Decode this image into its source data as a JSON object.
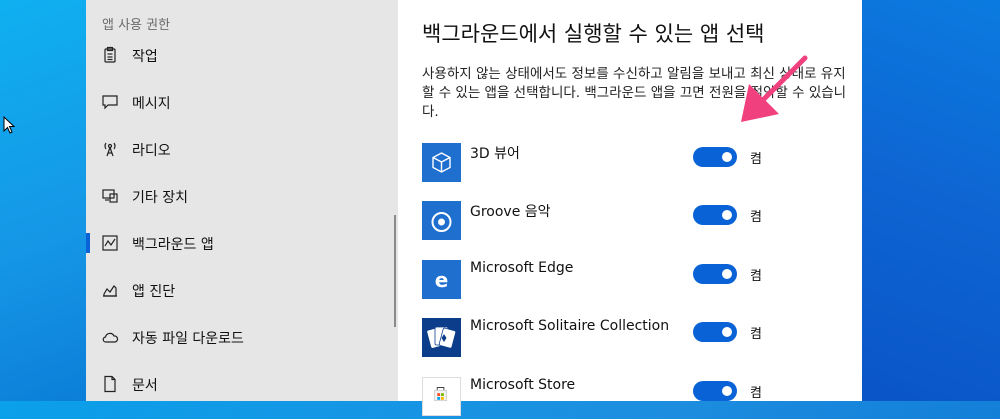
{
  "sidebar": {
    "section_title": "앱 사용 권한",
    "items": [
      {
        "label": "작업",
        "icon": "clipboard-icon"
      },
      {
        "label": "메시지",
        "icon": "chat-icon"
      },
      {
        "label": "라디오",
        "icon": "radio-tower-icon"
      },
      {
        "label": "기타 장치",
        "icon": "devices-icon"
      },
      {
        "label": "백그라운드 앱",
        "icon": "background-apps-icon",
        "active": true
      },
      {
        "label": "앱 진단",
        "icon": "diagnostics-icon"
      },
      {
        "label": "자동 파일 다운로드",
        "icon": "cloud-icon"
      },
      {
        "label": "문서",
        "icon": "document-icon"
      }
    ]
  },
  "main": {
    "title": "백그라운드에서 실행할 수 있는 앱 선택",
    "description": "사용하지 않는 상태에서도 정보를 수신하고 알림을 보내고 최신 상태로 유지할 수 있는 앱을 선택합니다. 백그라운드 앱을 끄면 전원을 절약할 수 있습니다.",
    "apps": [
      {
        "name": "3D 뷰어",
        "icon": "3d-cube-icon",
        "toggle": "켬",
        "on": true
      },
      {
        "name": "Groove 음악",
        "icon": "groove-music-icon",
        "toggle": "켬",
        "on": true
      },
      {
        "name": "Microsoft Edge",
        "icon": "edge-icon",
        "toggle": "켬",
        "on": true
      },
      {
        "name": "Microsoft Solitaire Collection",
        "icon": "solitaire-cards-icon",
        "toggle": "켬",
        "on": true
      },
      {
        "name": "Microsoft Store",
        "icon": "store-bag-icon",
        "toggle": "켬",
        "on": true
      }
    ]
  },
  "colors": {
    "accent": "#0a63d6",
    "annotation_arrow": "#f0417e",
    "sidebar_bg": "#e6e6e6"
  }
}
